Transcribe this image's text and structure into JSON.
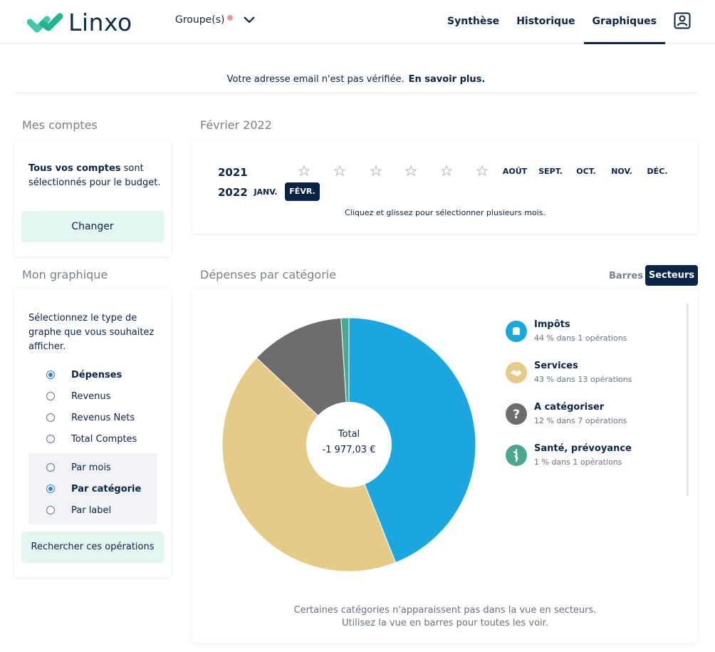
{
  "header": {
    "brand": "Linxo",
    "group_label": "Groupe(s)",
    "nav": [
      "Synthèse",
      "Historique",
      "Graphiques"
    ],
    "active_nav": "Graphiques"
  },
  "notice": {
    "text": "Votre adresse email n'est pas vérifiée.",
    "link": "En savoir plus."
  },
  "accounts": {
    "title": "Mes comptes",
    "text_bold": "Tous vos comptes",
    "text_rest": " sont sélectionnés pour le budget.",
    "button": "Changer"
  },
  "my_graph": {
    "title": "Mon graphique",
    "description": "Sélectionnez le type de graphe que vous souhaitez afficher.",
    "types": [
      {
        "label": "Dépenses",
        "checked": true
      },
      {
        "label": "Revenus",
        "checked": false
      },
      {
        "label": "Revenus Nets",
        "checked": false
      },
      {
        "label": "Total Comptes",
        "checked": false
      }
    ],
    "groupings": [
      {
        "label": "Par mois",
        "checked": false
      },
      {
        "label": "Par catégorie",
        "checked": true
      },
      {
        "label": "Par label",
        "checked": false
      }
    ],
    "button": "Rechercher ces opérations"
  },
  "period": {
    "title": "Février 2022",
    "years": [
      "2021",
      "2022"
    ],
    "months_2021_labels": [
      "AOÛT",
      "SEPT.",
      "OCT.",
      "NOV.",
      "DÉC."
    ],
    "months_2022_labels": [
      "JANV.",
      "FÉVR."
    ],
    "selected": "FÉVR.",
    "hint": "Cliquez et glissez pour sélectionner plusieurs mois."
  },
  "expenses": {
    "title": "Dépenses par catégorie",
    "view_bars": "Barres",
    "view_sectors": "Secteurs",
    "total_label": "Total",
    "total_value": "-1 977,03 €",
    "legend": [
      {
        "name": "Impôts",
        "detail": "44 % dans 1 opérations",
        "color": "#1aa7e0",
        "icon": "tax-icon"
      },
      {
        "name": "Services",
        "detail": "43 % dans 13 opérations",
        "color": "#e6cb88",
        "icon": "handshake-icon"
      },
      {
        "name": "A catégoriser",
        "detail": "12 % dans 7 opérations",
        "color": "#6d6d6d",
        "icon": "question-icon"
      },
      {
        "name": "Santé, prévoyance",
        "detail": "1 % dans 1 opérations",
        "color": "#4aa891",
        "icon": "health-icon"
      }
    ],
    "footnote_1": "Certaines catégories n'apparaissent pas dans la vue en secteurs.",
    "footnote_2": "Utilisez la vue en barres pour toutes les voir."
  },
  "chart_data": {
    "type": "pie",
    "categories": [
      "Impôts",
      "Services",
      "A catégoriser",
      "Santé, prévoyance"
    ],
    "values": [
      44,
      43,
      12,
      1
    ],
    "colors": [
      "#1aa7e0",
      "#e6cb88",
      "#6d6d6d",
      "#4aa891"
    ]
  }
}
